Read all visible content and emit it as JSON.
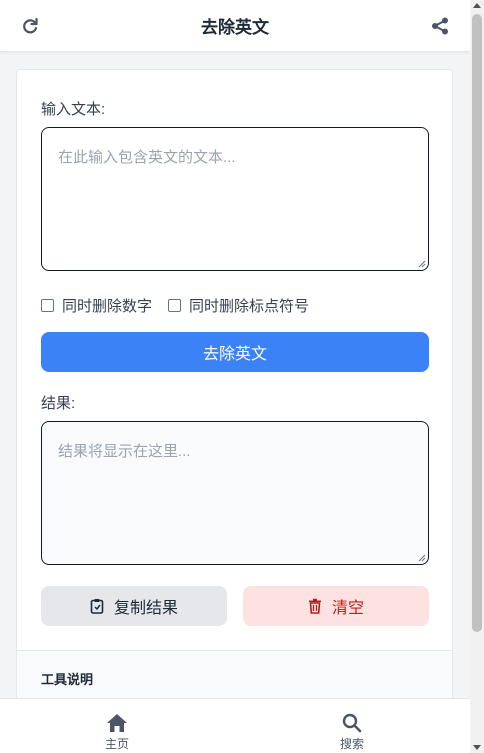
{
  "header": {
    "title": "去除英文",
    "left_icon": "refresh-icon",
    "right_icon": "share-icon"
  },
  "form": {
    "input_label": "输入文本:",
    "input_placeholder": "在此输入包含英文的文本...",
    "options": [
      {
        "label": "同时删除数字",
        "checked": false
      },
      {
        "label": "同时删除标点符号",
        "checked": false
      }
    ],
    "submit_label": "去除英文",
    "result_label": "结果:",
    "result_placeholder": "结果将显示在这里...",
    "copy_label": "复制结果",
    "clear_label": "清空"
  },
  "info": {
    "title": "工具说明"
  },
  "bottom_nav": {
    "items": [
      {
        "label": "主页",
        "icon": "home-icon"
      },
      {
        "label": "搜索",
        "icon": "search-icon"
      }
    ]
  },
  "colors": {
    "primary": "#3b82f6",
    "danger_bg": "#fee2e2",
    "danger_text": "#b91c1c",
    "neutral_bg": "#e5e7eb"
  }
}
